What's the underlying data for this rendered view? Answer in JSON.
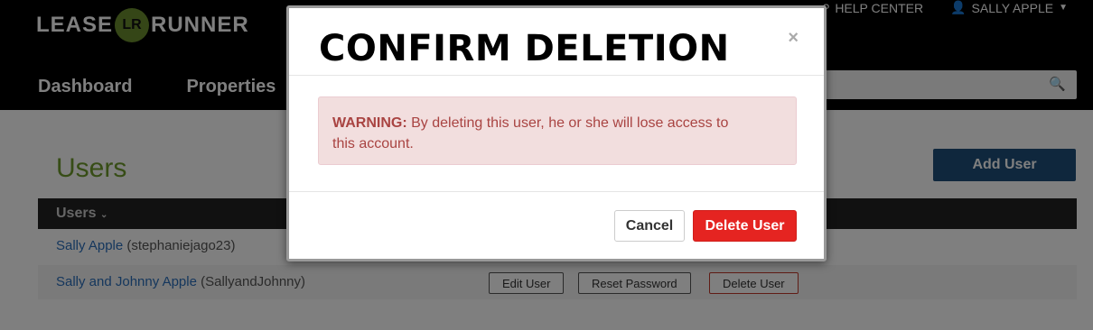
{
  "header": {
    "logo_left": "LEASE",
    "logo_mark": "LR",
    "logo_right": "RUNNER",
    "help_center": "HELP CENTER",
    "user_menu": "SALLY APPLE",
    "nav": [
      "Dashboard",
      "Properties"
    ],
    "search_placeholder": ""
  },
  "page": {
    "title": "Users",
    "add_user_label": "Add User",
    "table": {
      "column_header": "Users",
      "rows": [
        {
          "name": "Sally Apple",
          "handle": "(stephaniejago23)"
        },
        {
          "name": "Sally and Johnny Apple",
          "handle": "(SallyandJohnny)"
        }
      ],
      "row_actions": [
        "Edit User",
        "Reset Password",
        "Delete User"
      ]
    }
  },
  "modal": {
    "title": "CONFIRM DELETION",
    "close_glyph": "×",
    "warning_label": "WARNING:",
    "warning_text": " By deleting this user, he or she will lose access to\nthis account.",
    "cancel_label": "Cancel",
    "confirm_label": "Delete User"
  },
  "colors": {
    "accent_green": "#6e9a2c",
    "danger_red": "#e52421",
    "alert_bg": "#f2dede",
    "alert_text": "#a94442",
    "link_blue": "#2a6ebb"
  }
}
